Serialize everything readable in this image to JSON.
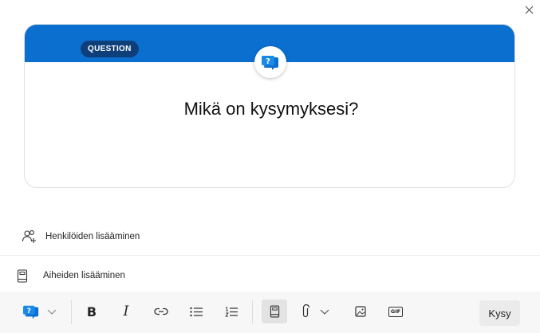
{
  "card": {
    "badge": "QUESTION",
    "question_placeholder": "Mikä on kysymyksesi?",
    "header_color": "#0b6fd0",
    "icon": "question-bubble-icon"
  },
  "add_people": {
    "label": "Henkilöiden lisääminen",
    "icon": "add-person-icon"
  },
  "add_topics": {
    "label": "Aiheiden lisääminen",
    "icon": "book-icon"
  },
  "toolbar": {
    "items": [
      "question-type-icon",
      "bold-icon",
      "italic-icon",
      "link-icon",
      "bulleted-list-icon",
      "numbered-list-icon",
      "topic-book-icon",
      "attach-icon",
      "image-icon",
      "gif-icon"
    ],
    "bold_glyph": "B",
    "italic_glyph": "I",
    "gif_label": "GIF",
    "send_label": "Kysy"
  }
}
